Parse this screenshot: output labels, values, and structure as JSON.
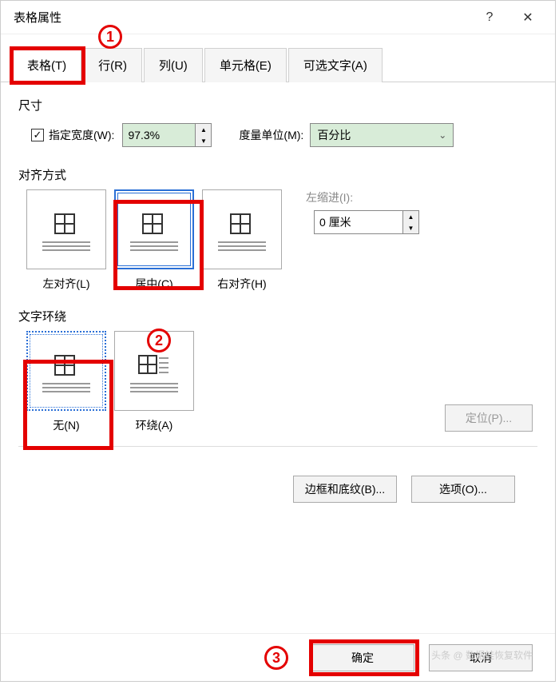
{
  "title": "表格属性",
  "help": "?",
  "close": "✕",
  "tabs": {
    "table": "表格(T)",
    "row": "行(R)",
    "col": "列(U)",
    "cell": "单元格(E)",
    "alt": "可选文字(A)"
  },
  "size": {
    "label": "尺寸",
    "checkbox": "指定宽度(W):",
    "width_value": "97.3%",
    "unit_label": "度量单位(M):",
    "unit_value": "百分比"
  },
  "align": {
    "label": "对齐方式",
    "left": "左对齐(L)",
    "center": "居中(C)",
    "right": "右对齐(H)",
    "indent_label": "左缩进(I):",
    "indent_value": "0 厘米"
  },
  "wrap": {
    "label": "文字环绕",
    "none": "无(N)",
    "around": "环绕(A)",
    "position": "定位(P)..."
  },
  "footer_in": {
    "border": "边框和底纹(B)...",
    "options": "选项(O)..."
  },
  "footer": {
    "ok": "确定",
    "cancel": "取消"
  },
  "callouts": {
    "n1": "1",
    "n2": "2",
    "n3": "3"
  },
  "watermark": "头条 @ 数据蛙恢复软件"
}
